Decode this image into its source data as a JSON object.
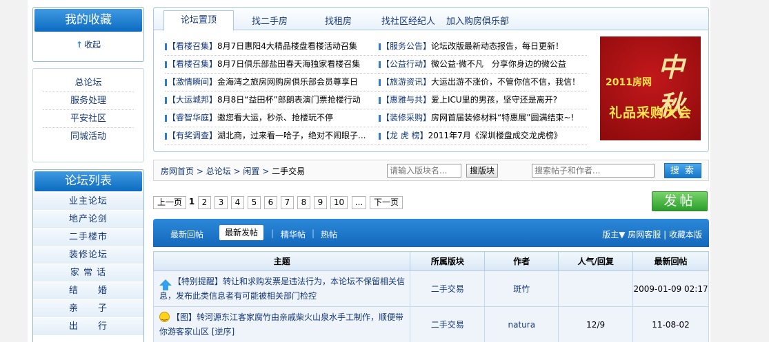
{
  "sidebar": {
    "favorites_title": "我的收藏",
    "collapse_label": "收起",
    "collapse_icon": "arrow-up-icon",
    "nav_links": [
      "总论坛",
      "服务处理",
      "平安社区",
      "同城活动"
    ],
    "forum_list_title": "论坛列表",
    "forum_items": [
      "业主论坛",
      "地产论剑",
      "二手楼市",
      "装修论坛",
      "家 常 话",
      "结　　婚",
      "亲　　子",
      "出　　行"
    ]
  },
  "top_tabs": [
    "论坛置顶",
    "找二手房",
    "找租房",
    "找社区经纪人",
    "加入购房俱乐部"
  ],
  "news_left": [
    {
      "tag": "【看楼召集】",
      "text": "8月7日惠阳4大精品楼盘看楼活动召集"
    },
    {
      "tag": "【看楼召集】",
      "text": "8月7日俱乐部盐田春天海独家看楼召集"
    },
    {
      "tag": "【激情瞬间】",
      "text": "金海湾之旅房网购房俱乐部会员尊享日"
    },
    {
      "tag": "【大运城邦】",
      "text": "8月8日“益田杯”郎朗表演门票抢楼行动"
    },
    {
      "tag": "【睿智华庭】",
      "text": "邀您看大运，秒杀、抢楼玩不停"
    },
    {
      "tag": "【有奖调查】",
      "text": "湖北商，过来看一哈子，绝对不闹眼子..."
    }
  ],
  "news_right": [
    {
      "tag": "【服务公告】",
      "text": "论坛改版最新动态报告，每日更新！"
    },
    {
      "tag": "【公益行动】",
      "text": "微公益·微不凡　分享你身边的微公益"
    },
    {
      "tag": "【旅游资讯】",
      "text": "大运出游不涨价，不管你信不信，我信！"
    },
    {
      "tag": "【惠雅与共】",
      "text": "爱上ICU里的男孩，坚守还是离开?"
    },
    {
      "tag": "【装修采购】",
      "text": "房网首届装修材料“特惠展”圆满结束~!"
    },
    {
      "tag": "【龙 虎 榜】",
      "text": "2011年7月《深圳楼盘成交龙虎榜》"
    }
  ],
  "ad": {
    "year_text": "2011房网",
    "calligraphy": "中秋",
    "headline": "礼品采购大会"
  },
  "breadcrumb": {
    "home": "房网首页",
    "forum": "总论坛",
    "section": "闲置",
    "current": "二手交易",
    "sep": " > "
  },
  "search": {
    "board_placeholder": "请输入版块名...",
    "board_button": "搜版块",
    "post_placeholder": "搜索帖子和作者...",
    "post_button": "搜 索"
  },
  "pager": {
    "prev": "上一页",
    "next": "下一页",
    "current": "1",
    "pages": [
      "2",
      "3",
      "4",
      "5",
      "6",
      "7",
      "8",
      "9",
      "10",
      "..."
    ]
  },
  "post_button": "发帖",
  "thread_tabs": [
    "最新回帖",
    "最新发帖",
    "精华帖",
    "热帖"
  ],
  "thread_right": {
    "moderator": "版主",
    "moderator_name": "房网客服",
    "collect": "收藏本版"
  },
  "table": {
    "headers": [
      "主题",
      "所属版块",
      "作者",
      "人气/回复",
      "最新回帖"
    ],
    "rows": [
      {
        "icon": "arrow-up-icon",
        "subject": "【特别提醒】转让和求购发票是违法行为，本论坛不保留相关信息，发布此类信息者有可能被相关部门检控",
        "board": "二手交易",
        "author": "斑竹",
        "stats": "",
        "latest": "2009-01-09 02:17"
      },
      {
        "icon": "smile-icon",
        "subject": "【图】转河源东江客家腐竹由亲戚柴火山泉水手工制作，顺便带你游客家山区 [逆序]",
        "board": "二手交易",
        "author": "natura",
        "stats": "12/9",
        "latest": "11-08-02"
      }
    ]
  }
}
